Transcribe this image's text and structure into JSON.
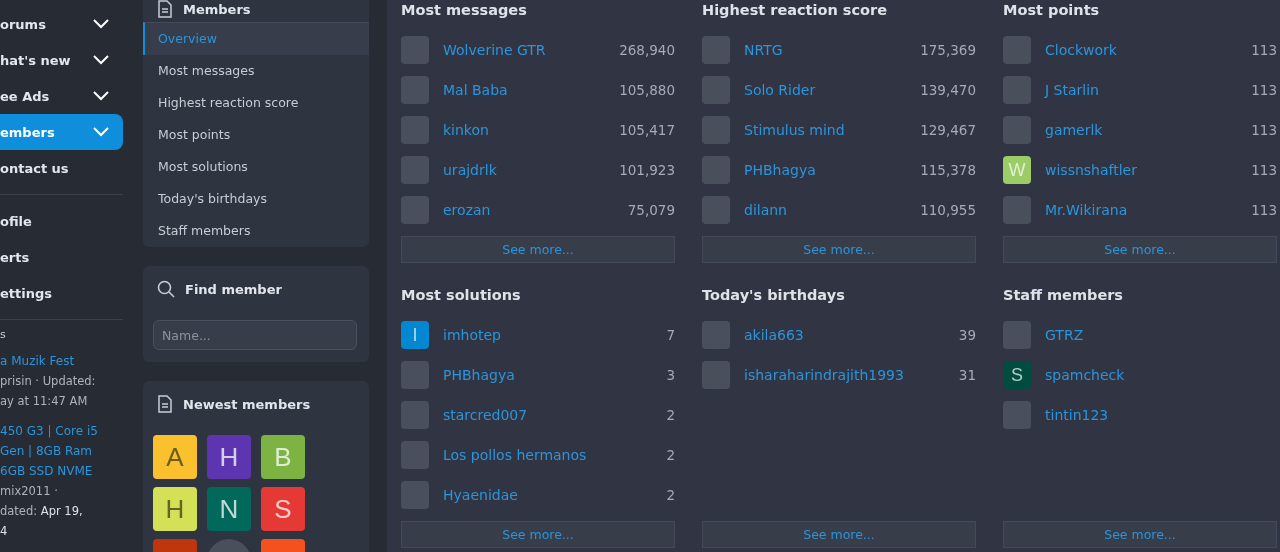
{
  "nav": {
    "items": [
      {
        "label": "orums",
        "chevron": true,
        "selected": false
      },
      {
        "label": "hat's new",
        "chevron": true,
        "selected": false
      },
      {
        "label": "ee Ads",
        "chevron": true,
        "selected": false
      },
      {
        "label": "embers",
        "chevron": true,
        "selected": true
      },
      {
        "label": "ontact us",
        "chevron": false,
        "selected": false
      }
    ],
    "account": [
      "ofile",
      "erts",
      "ettings"
    ],
    "section_heading": "s",
    "entries": [
      {
        "title": "a Muzik Fest",
        "meta": [
          {
            "text": "prisin · Updated:",
            "bold": false
          },
          {
            "text": "ay at 11:47 AM",
            "bold": false
          }
        ]
      },
      {
        "title": "450 G3 | Core i5\nGen | 8GB Ram\n6GB SSD NVME",
        "meta": [
          {
            "text": "mix2011 ·",
            "bold": false
          },
          {
            "text": "dated: **Apr 19,**",
            "bold": false
          },
          {
            "text": "4",
            "bold": true
          }
        ]
      }
    ]
  },
  "members_block": {
    "title": "Members",
    "items": [
      {
        "label": "Overview",
        "selected": true
      },
      {
        "label": "Most messages",
        "selected": false
      },
      {
        "label": "Highest reaction score",
        "selected": false
      },
      {
        "label": "Most points",
        "selected": false
      },
      {
        "label": "Most solutions",
        "selected": false
      },
      {
        "label": "Today's birthdays",
        "selected": false
      },
      {
        "label": "Staff members",
        "selected": false
      }
    ]
  },
  "find_member": {
    "title": "Find member",
    "placeholder": "Name..."
  },
  "newest_members": {
    "title": "Newest members",
    "tiles": [
      {
        "kind": "letter",
        "letter": "A",
        "color": "#fbc02d"
      },
      {
        "kind": "letter",
        "letter": "H",
        "color": "#5e35b1"
      },
      {
        "kind": "letter",
        "letter": "B",
        "color": "#7cb342"
      },
      {
        "kind": "letter",
        "letter": "H",
        "color": "#d4e157"
      },
      {
        "kind": "letter",
        "letter": "N",
        "color": "#00695c"
      },
      {
        "kind": "letter",
        "letter": "S",
        "color": "#e53935"
      },
      {
        "kind": "blank",
        "color": "#bf360c"
      },
      {
        "kind": "photo"
      },
      {
        "kind": "blank",
        "color": "#f4511e"
      }
    ]
  },
  "sections": [
    {
      "title": "Most messages",
      "rows": [
        {
          "avatar": {
            "kind": "photo"
          },
          "name": "Wolverine GTR",
          "value": "268,940"
        },
        {
          "avatar": {
            "kind": "photo"
          },
          "name": "Mal Baba",
          "value": "105,880"
        },
        {
          "avatar": {
            "kind": "photo"
          },
          "name": "kinkon",
          "value": "105,417"
        },
        {
          "avatar": {
            "kind": "photo"
          },
          "name": "urajdrlk",
          "value": "101,923"
        },
        {
          "avatar": {
            "kind": "photo"
          },
          "name": "erozan",
          "value": "75,079"
        }
      ],
      "more": "See more..."
    },
    {
      "title": "Highest reaction score",
      "rows": [
        {
          "avatar": {
            "kind": "photo"
          },
          "name": "NRTG",
          "value": "175,369"
        },
        {
          "avatar": {
            "kind": "photo"
          },
          "name": "Solo Rider",
          "value": "139,470"
        },
        {
          "avatar": {
            "kind": "photo"
          },
          "name": "Stimulus mind",
          "value": "129,467"
        },
        {
          "avatar": {
            "kind": "photo"
          },
          "name": "PHBhagya",
          "value": "115,378"
        },
        {
          "avatar": {
            "kind": "photo"
          },
          "name": "dilann",
          "value": "110,955"
        }
      ],
      "more": "See more..."
    },
    {
      "title": "Most points",
      "rows": [
        {
          "avatar": {
            "kind": "photo"
          },
          "name": "Clockwork",
          "value": "113"
        },
        {
          "avatar": {
            "kind": "photo"
          },
          "name": "J Starlin",
          "value": "113"
        },
        {
          "avatar": {
            "kind": "photo"
          },
          "name": "gamerlk",
          "value": "113"
        },
        {
          "avatar": {
            "kind": "letter",
            "letter": "W",
            "color": "#9ccc65"
          },
          "name": "wissnshaftler",
          "value": "113"
        },
        {
          "avatar": {
            "kind": "photo"
          },
          "name": "Mr.Wikirana",
          "value": "113"
        }
      ],
      "more": "See more..."
    },
    {
      "title": "Most solutions",
      "rows": [
        {
          "avatar": {
            "kind": "letter",
            "letter": "I",
            "color": "#0288d1"
          },
          "name": "imhotep",
          "value": "7"
        },
        {
          "avatar": {
            "kind": "photo"
          },
          "name": "PHBhagya",
          "value": "3"
        },
        {
          "avatar": {
            "kind": "photo"
          },
          "name": "starcred007",
          "value": "2"
        },
        {
          "avatar": {
            "kind": "photo"
          },
          "name": "Los pollos hermanos",
          "value": "2"
        },
        {
          "avatar": {
            "kind": "photo"
          },
          "name": "Hyaenidae",
          "value": "2"
        }
      ],
      "more": "See more..."
    },
    {
      "title": "Today's birthdays",
      "rows": [
        {
          "avatar": {
            "kind": "photo"
          },
          "name": "akila663",
          "value": "39"
        },
        {
          "avatar": {
            "kind": "photo"
          },
          "name": "isharaharindrajith1993",
          "value": "31"
        }
      ],
      "more": "See more..."
    },
    {
      "title": "Staff members",
      "rows": [
        {
          "avatar": {
            "kind": "photo"
          },
          "name": "GTRZ"
        },
        {
          "avatar": {
            "kind": "letter",
            "letter": "S",
            "color": "#004d40"
          },
          "name": "spamcheck"
        },
        {
          "avatar": {
            "kind": "photo"
          },
          "name": "tintin123"
        }
      ],
      "more": "See more..."
    }
  ]
}
